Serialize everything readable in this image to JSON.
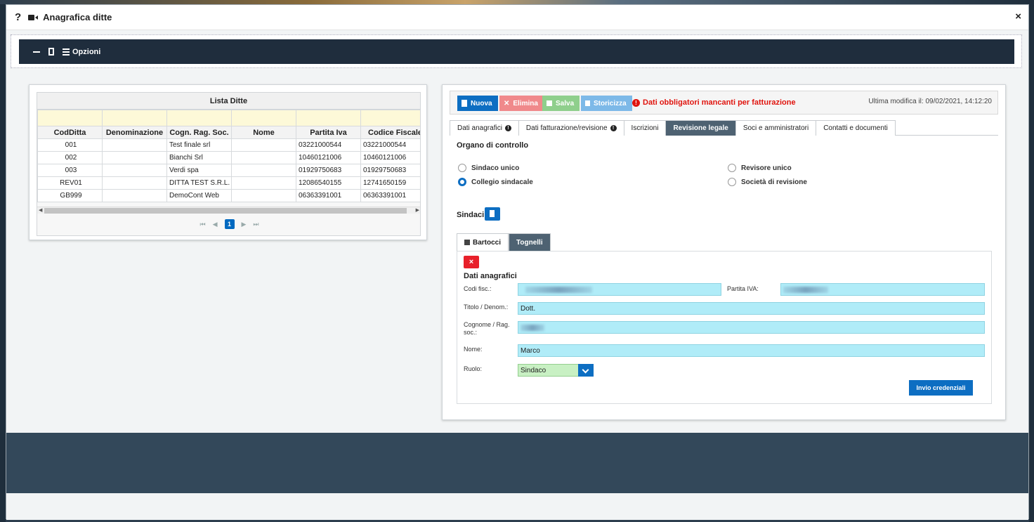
{
  "modal": {
    "help_icon": "?",
    "title": "Anagrafica ditte",
    "close": "×"
  },
  "toolbar": {
    "options_label": "Opzioni"
  },
  "grid": {
    "caption": "Lista Ditte",
    "columns": [
      "CodDitta",
      "Denominazione",
      "Cogn. Rag. Soc.",
      "Nome",
      "Partita Iva",
      "Codice Fiscale"
    ],
    "rows": [
      [
        "001",
        "",
        "Test finale srl",
        "",
        "03221000544",
        "03221000544"
      ],
      [
        "002",
        "",
        "Bianchi Srl",
        "",
        "10460121006",
        "10460121006"
      ],
      [
        "003",
        "",
        "Verdi spa",
        "",
        "01929750683",
        "01929750683"
      ],
      [
        "REV01",
        "",
        "DITTA TEST S.R.L.",
        "",
        "12086540155",
        "12741650159"
      ],
      [
        "GB999",
        "",
        "DemoCont Web",
        "",
        "06363391001",
        "06363391001"
      ]
    ],
    "pager": {
      "current": "1",
      "first": "⏮",
      "prev": "◀",
      "next": "▶",
      "last": "⏭"
    }
  },
  "actions": {
    "nuova": "Nuova",
    "elimina": "Elimina",
    "salva": "Salva",
    "storicizza": "Storicizza",
    "warning": "Dati obbligatori mancanti per fatturazione",
    "last_modified": "Ultima modifica il: 09/02/2021, 14:12:20"
  },
  "tabs": [
    "Dati anagrafici",
    "Dati fatturazione/revisione",
    "Iscrizioni",
    "Revisione legale",
    "Soci e amministratori",
    "Contatti e documenti"
  ],
  "revisione": {
    "organo_title": "Organo di controllo",
    "options": {
      "sindaco_unico": "Sindaco unico",
      "collegio_sindacale": "Collegio sindacale",
      "revisore_unico": "Revisore unico",
      "societa_revisione": "Società di revisione"
    },
    "selected": "collegio_sindacale",
    "sindaci_title": "Sindaci",
    "subtabs": [
      "Bartocci",
      "Tognelli"
    ],
    "delete_label": "×",
    "dati_title": "Dati anagrafici",
    "labels": {
      "cod_fisc": "Codi fisc.:",
      "partita_iva": "Partita IVA:",
      "titolo": "Titolo / Denom.:",
      "cognome": "Cognome / Rag. soc.:",
      "nome": "Nome:",
      "ruolo": "Ruolo:"
    },
    "values": {
      "titolo": "Dott.",
      "nome": "Marco",
      "ruolo": "Sindaco"
    },
    "credenziali_button": "Invio credenziali"
  }
}
